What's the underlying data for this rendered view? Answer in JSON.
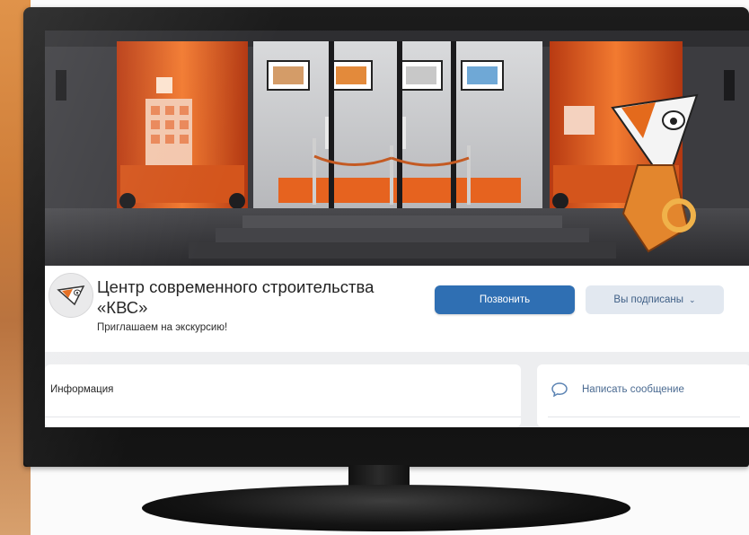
{
  "group": {
    "title": "Центр современного строительства «КВС»",
    "status": "Приглашаем на экскурсию!"
  },
  "actions": {
    "call_label": "Позвонить",
    "subscribed_label": "Вы подписаны",
    "subscribed_chevron": "⌄"
  },
  "cards": {
    "info_label": "Информация",
    "message_label": "Написать сообщение"
  },
  "icons": {
    "avatar": "kvs-logo-icon",
    "message": "chat-bubble-icon",
    "dropdown": "chevron-down-icon"
  },
  "colors": {
    "primary_button": "#2f6fb3",
    "secondary_button": "#e2e8f0",
    "accent_orange": "#f06a1c"
  }
}
